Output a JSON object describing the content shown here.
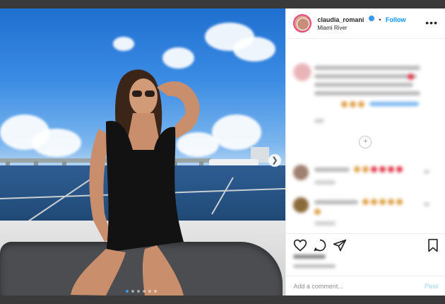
{
  "post": {
    "username": "claudia_romani",
    "follow_label": "Follow",
    "separator": "•",
    "location": "Miami River",
    "more_label": "•••"
  },
  "comment_box": {
    "placeholder": "Add a comment...",
    "post_label": "Post"
  },
  "carousel": {
    "total": 6,
    "active_index": 0
  },
  "colors": {
    "accent": "#0095f6",
    "verified": "#3897f0",
    "post_disabled": "#b2dffc",
    "story_ring": "#e94b7a"
  },
  "icons": [
    "heart-icon",
    "comment-icon",
    "share-icon",
    "bookmark-icon",
    "more-options-icon",
    "verified-badge-icon",
    "next-arrow-icon",
    "load-more-icon"
  ]
}
